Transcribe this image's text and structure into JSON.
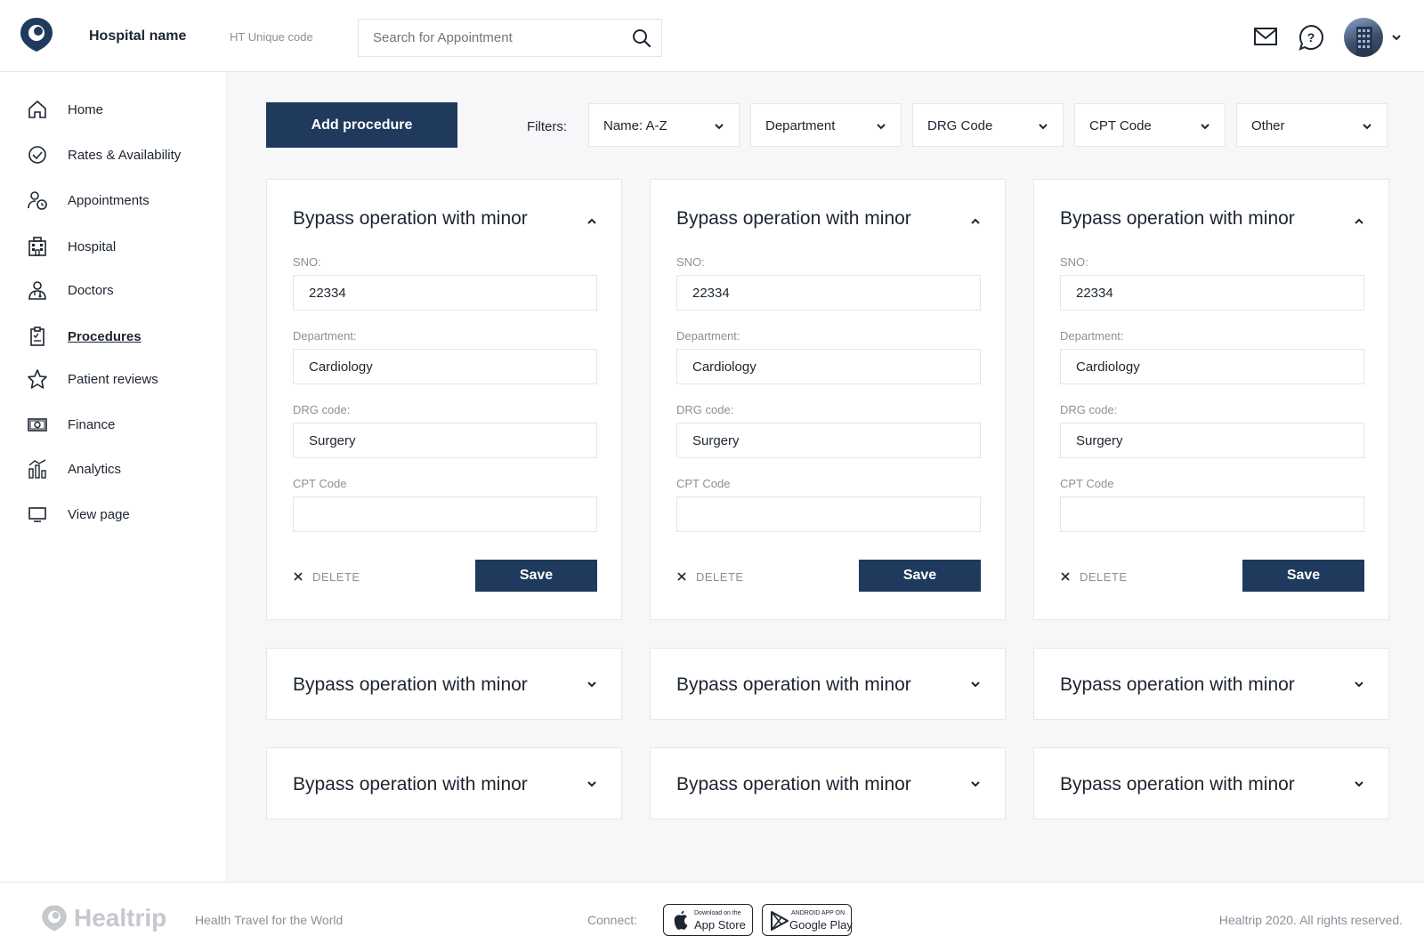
{
  "header": {
    "hospital_name": "Hospital name",
    "unique_code": "HT Unique code",
    "search_placeholder": "Search for Appointment",
    "icons": [
      "logo-icon",
      "search-icon",
      "mail-icon",
      "help-icon",
      "chevron-down-icon"
    ]
  },
  "sidebar": {
    "items": [
      {
        "label": "Home",
        "icon": "home-icon"
      },
      {
        "label": "Rates & Availability",
        "icon": "check-circle-icon"
      },
      {
        "label": "Appointments",
        "icon": "user-clock-icon"
      },
      {
        "label": "Hospital",
        "icon": "building-icon"
      },
      {
        "label": "Doctors",
        "icon": "doctor-icon"
      },
      {
        "label": "Procedures",
        "icon": "clipboard-icon",
        "active": true
      },
      {
        "label": "Patient reviews",
        "icon": "star-icon"
      },
      {
        "label": "Finance",
        "icon": "cash-icon"
      },
      {
        "label": "Analytics",
        "icon": "chart-icon"
      },
      {
        "label": "View page",
        "icon": "monitor-icon"
      }
    ]
  },
  "toolbar": {
    "add_label": "Add procedure",
    "filters_label": "Filters:",
    "filters": [
      "Name: A-Z",
      "Department",
      "DRG Code",
      "CPT Code",
      "Other"
    ]
  },
  "cards": {
    "title": "Bypass operation with minor",
    "sno_label": "SNO:",
    "department_label": "Department:",
    "drg_label": "DRG code:",
    "cpt_label": "CPT Code",
    "delete_label": "DELETE",
    "save_label": "Save",
    "expanded": [
      {
        "sno": "22334",
        "department": "Cardiology",
        "drg": "Surgery",
        "cpt": ""
      },
      {
        "sno": "22334",
        "department": "Cardiology",
        "drg": "Surgery",
        "cpt": ""
      },
      {
        "sno": "22334",
        "department": "Cardiology",
        "drg": "Surgery",
        "cpt": ""
      }
    ],
    "collapsed_count": 6
  },
  "footer": {
    "logo_text": "Healtrip",
    "tagline": "Health Travel for the World",
    "connect_label": "Connect:",
    "app_store_small": "Download on the",
    "app_store_big": "App Store",
    "google_play_small": "ANDROID APP ON",
    "google_play_big": "Google Play",
    "copyright": "Healtrip 2020. All rights reserved."
  },
  "colors": {
    "primary": "#1f3a5c",
    "text": "#1c2530",
    "muted": "#8a9099",
    "border": "#e6e7ea",
    "background": "#f7f7f9"
  }
}
